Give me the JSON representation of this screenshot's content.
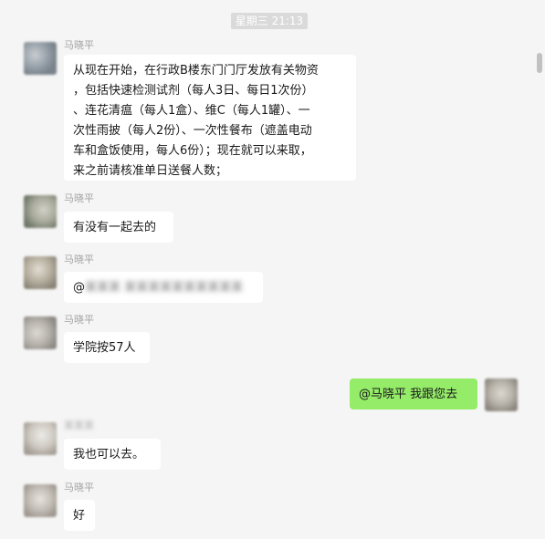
{
  "timestamp": "星期三 21:13",
  "messages": [
    {
      "sender": "马晓平",
      "text": "从现在开始，在行政B楼东门门厅发放有关物资\n，包括快速检测试剂（每人3日、每日1次份）\n、连花清瘟（每人1盒）、维C（每人1罐）、一\n次性雨披（每人2份）、一次性餐布（遮盖电动\n车和盒饭使用，每人6份）；现在就可以来取，\n来之前请核准单日送餐人数；"
    },
    {
      "sender": "马晓平",
      "text": "有没有一起去的"
    },
    {
      "sender": "马晓平",
      "text_prefix": "@",
      "text_redacted": "某某某 某某某某某某某某某某"
    },
    {
      "sender": "马晓平",
      "text": "学院按57人"
    },
    {
      "sender": "me",
      "text": "@马晓平 我跟您去"
    },
    {
      "sender": "某某某",
      "text": "我也可以去。"
    },
    {
      "sender": "马晓平",
      "text": "好"
    }
  ]
}
